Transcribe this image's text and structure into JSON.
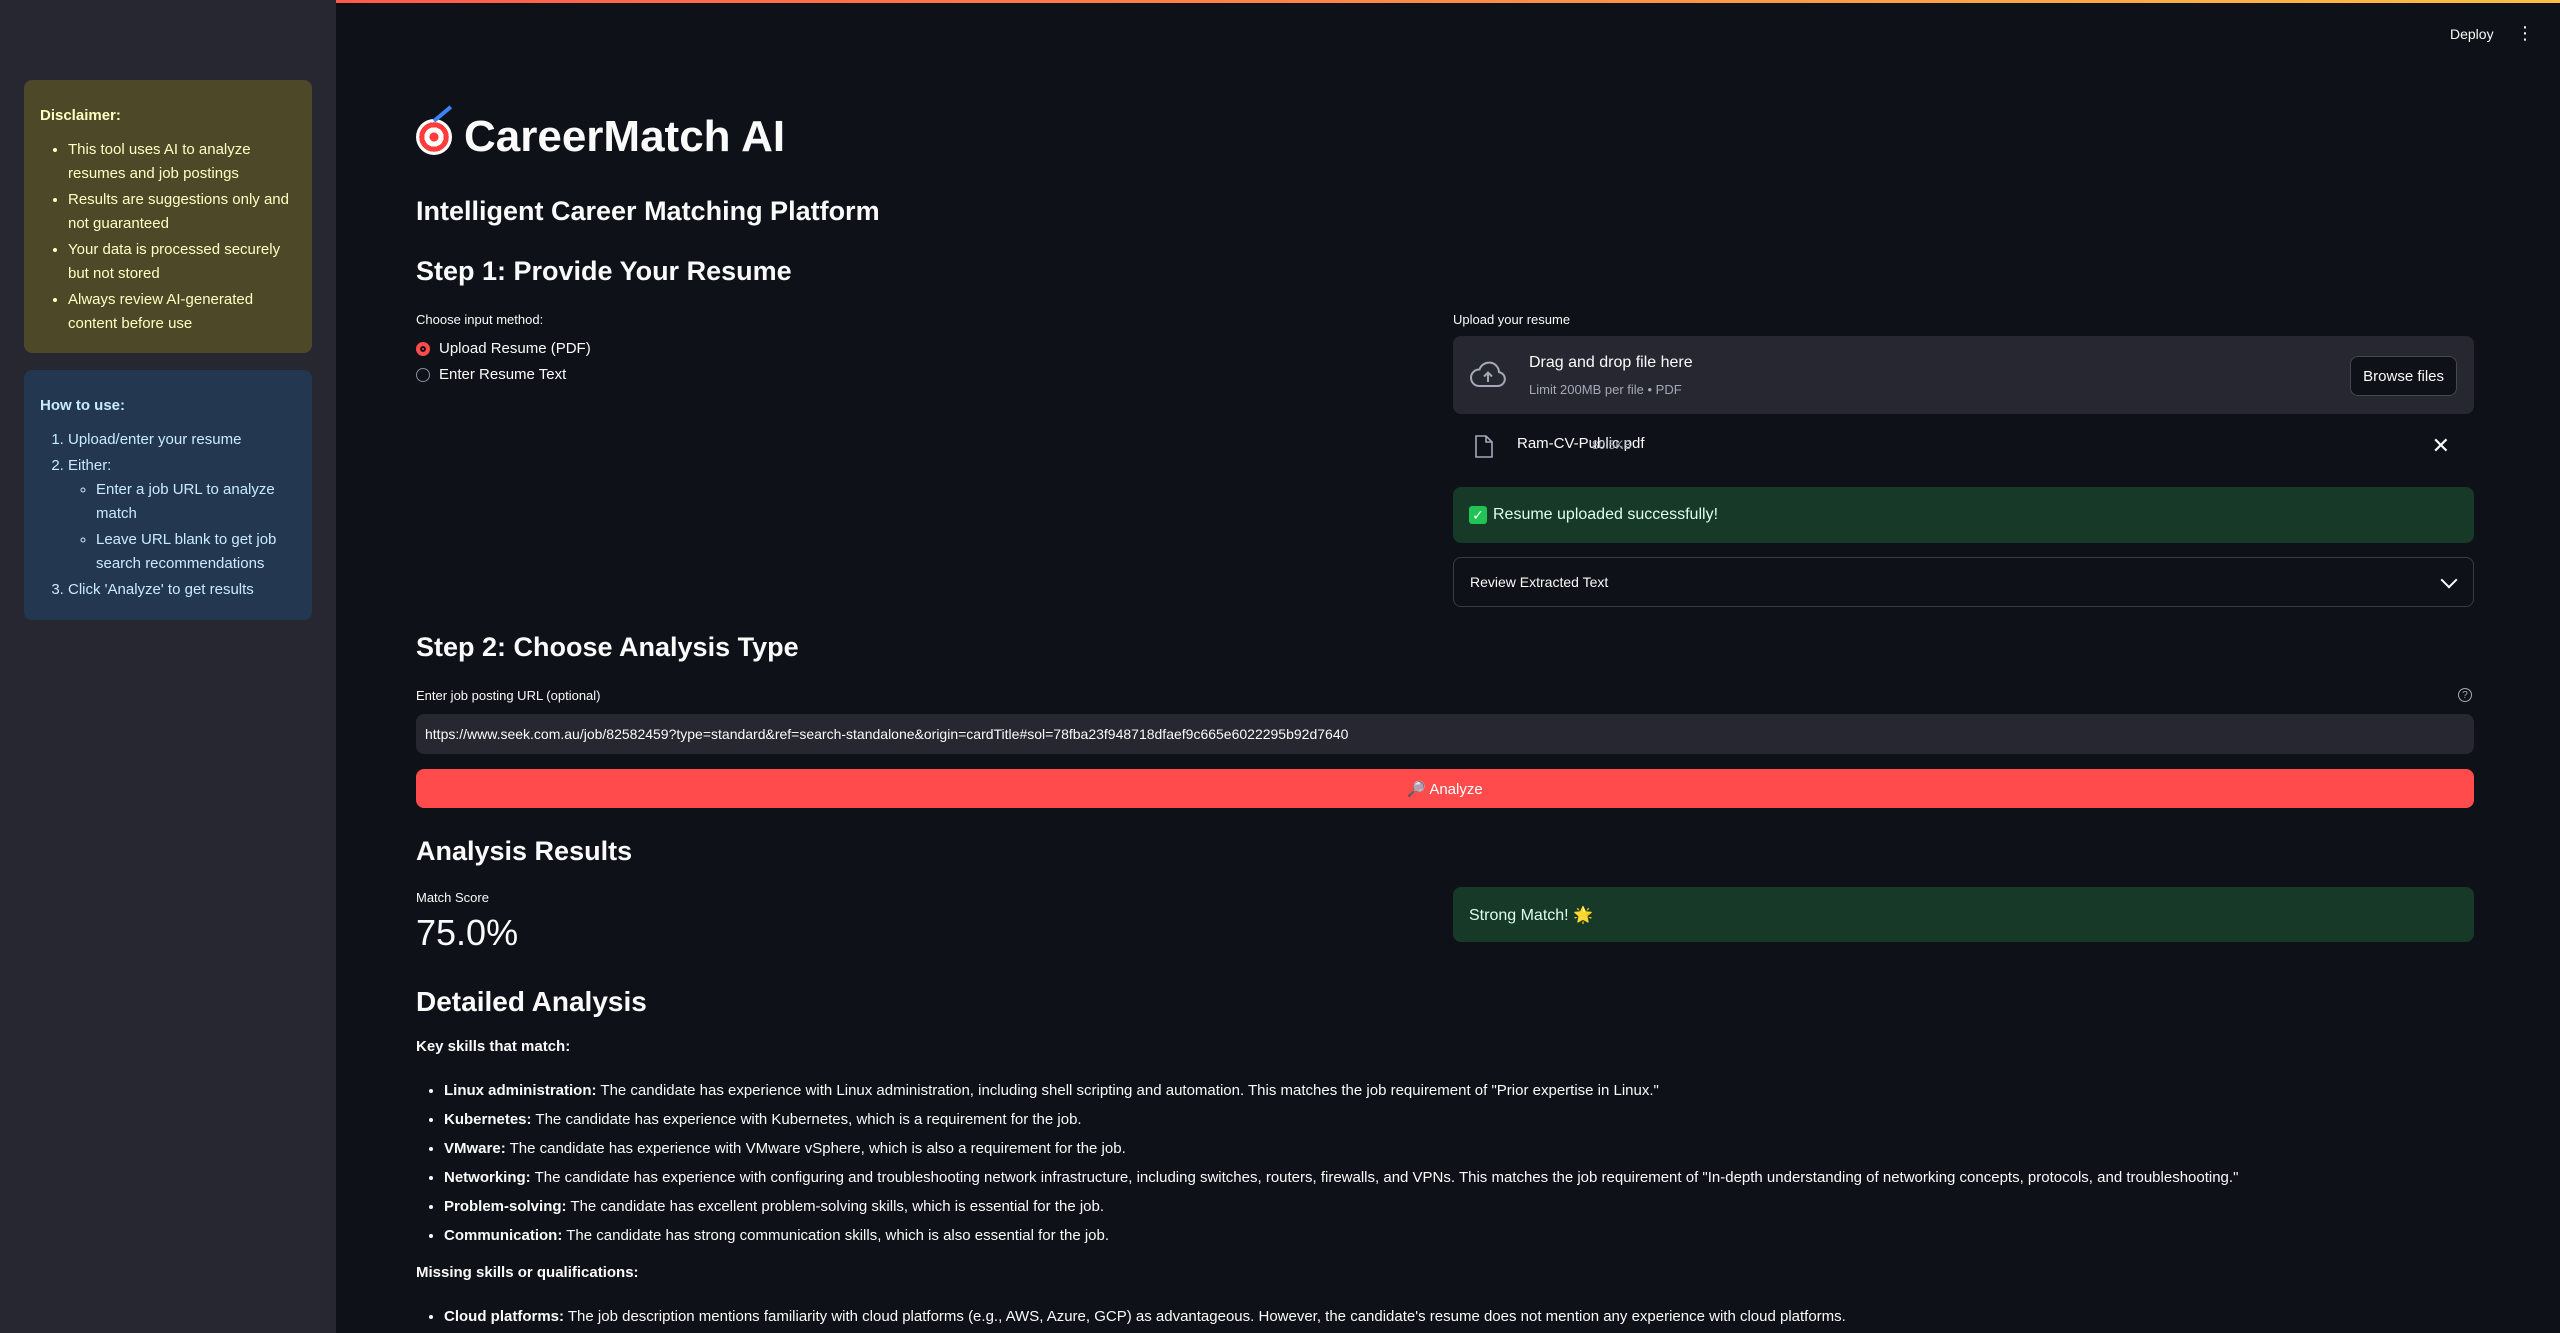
{
  "app": {
    "deploy_label": "Deploy"
  },
  "sidebar": {
    "disclaimer": {
      "title": "Disclaimer:",
      "items": [
        "This tool uses AI to analyze resumes and job postings",
        "Results are suggestions only and not guaranteed",
        "Your data is processed securely but not stored",
        "Always review AI-generated content before use"
      ]
    },
    "howto": {
      "title": "How to use:",
      "step1": "Upload/enter your resume",
      "step2": "Either:",
      "step2_sub": [
        "Enter a job URL to analyze match",
        "Leave URL blank to get job search recommendations"
      ],
      "step3": "Click 'Analyze' to get results"
    }
  },
  "main": {
    "title": "CareerMatch AI",
    "subtitle": "Intelligent Career Matching Platform",
    "step1": {
      "heading": "Step 1: Provide Your Resume",
      "input_method_label": "Choose input method:",
      "options": [
        "Upload Resume (PDF)",
        "Enter Resume Text"
      ],
      "selected_index": 0,
      "upload_label": "Upload your resume",
      "dropzone_title": "Drag and drop file here",
      "dropzone_sub": "Limit 200MB per file • PDF",
      "browse_label": "Browse files",
      "file_name": "Ram-CV-Public.pdf",
      "file_size": "80.5KB",
      "success_msg": "Resume uploaded successfully!",
      "expander_label": "Review Extracted Text"
    },
    "step2": {
      "heading": "Step 2: Choose Analysis Type",
      "url_label": "Enter job posting URL (optional)",
      "url_value": "https://www.seek.com.au/job/82582459?type=standard&ref=search-standalone&origin=cardTitle#sol=78fba23f948718dfaef9c665e6022295b92d7640",
      "analyze_label": "🔎 Analyze"
    },
    "results": {
      "heading": "Analysis Results",
      "metric_label": "Match Score",
      "metric_value": "75.0%",
      "verdict": "Strong Match! 🌟"
    },
    "detailed": {
      "heading": "Detailed Analysis",
      "matching_title": "Key skills that match:",
      "matching": [
        {
          "skill": "Linux administration:",
          "text": " The candidate has experience with Linux administration, including shell scripting and automation. This matches the job requirement of \"Prior expertise in Linux.\""
        },
        {
          "skill": "Kubernetes:",
          "text": " The candidate has experience with Kubernetes, which is a requirement for the job."
        },
        {
          "skill": "VMware:",
          "text": " The candidate has experience with VMware vSphere, which is also a requirement for the job."
        },
        {
          "skill": "Networking:",
          "text": " The candidate has experience with configuring and troubleshooting network infrastructure, including switches, routers, firewalls, and VPNs. This matches the job requirement of \"In-depth understanding of networking concepts, protocols, and troubleshooting.\""
        },
        {
          "skill": "Problem-solving:",
          "text": " The candidate has excellent problem-solving skills, which is essential for the job."
        },
        {
          "skill": "Communication:",
          "text": " The candidate has strong communication skills, which is also essential for the job."
        }
      ],
      "missing_title": "Missing skills or qualifications:",
      "missing": [
        {
          "skill": "Cloud platforms:",
          "text": " The job description mentions familiarity with cloud platforms (e.g., AWS, Azure, GCP) as advantageous. However, the candidate's resume does not mention any experience with cloud platforms."
        }
      ]
    }
  }
}
